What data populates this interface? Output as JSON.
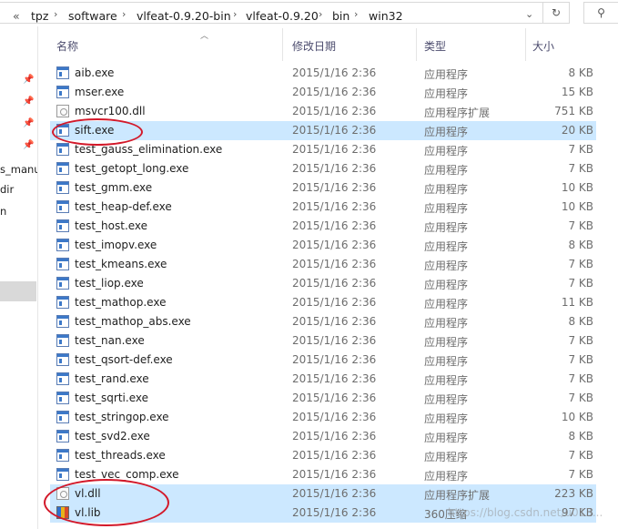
{
  "address": {
    "crumbs": [
      "tpz",
      "software",
      "vlfeat-0.9.20-bin",
      "vlfeat-0.9.20",
      "bin",
      "win32"
    ],
    "overflow": "«",
    "separator": "›"
  },
  "nav": {
    "texts": [
      "s_manu",
      "dir",
      "n"
    ]
  },
  "columns": {
    "name": "名称",
    "date": "修改日期",
    "type": "类型",
    "size": "大小"
  },
  "files": [
    {
      "name": "aib.exe",
      "date": "2015/1/16 2:36",
      "type": "应用程序",
      "size": "8 KB",
      "icon": "exe-icon"
    },
    {
      "name": "mser.exe",
      "date": "2015/1/16 2:36",
      "type": "应用程序",
      "size": "15 KB",
      "icon": "exe-icon"
    },
    {
      "name": "msvcr100.dll",
      "date": "2015/1/16 2:36",
      "type": "应用程序扩展",
      "size": "751 KB",
      "icon": "dll-icon"
    },
    {
      "name": "sift.exe",
      "date": "2015/1/16 2:36",
      "type": "应用程序",
      "size": "20 KB",
      "icon": "exe-icon"
    },
    {
      "name": "test_gauss_elimination.exe",
      "date": "2015/1/16 2:36",
      "type": "应用程序",
      "size": "7 KB",
      "icon": "exe-icon"
    },
    {
      "name": "test_getopt_long.exe",
      "date": "2015/1/16 2:36",
      "type": "应用程序",
      "size": "7 KB",
      "icon": "exe-icon"
    },
    {
      "name": "test_gmm.exe",
      "date": "2015/1/16 2:36",
      "type": "应用程序",
      "size": "10 KB",
      "icon": "exe-icon"
    },
    {
      "name": "test_heap-def.exe",
      "date": "2015/1/16 2:36",
      "type": "应用程序",
      "size": "10 KB",
      "icon": "exe-icon"
    },
    {
      "name": "test_host.exe",
      "date": "2015/1/16 2:36",
      "type": "应用程序",
      "size": "7 KB",
      "icon": "exe-icon"
    },
    {
      "name": "test_imopv.exe",
      "date": "2015/1/16 2:36",
      "type": "应用程序",
      "size": "8 KB",
      "icon": "exe-icon"
    },
    {
      "name": "test_kmeans.exe",
      "date": "2015/1/16 2:36",
      "type": "应用程序",
      "size": "7 KB",
      "icon": "exe-icon"
    },
    {
      "name": "test_liop.exe",
      "date": "2015/1/16 2:36",
      "type": "应用程序",
      "size": "7 KB",
      "icon": "exe-icon"
    },
    {
      "name": "test_mathop.exe",
      "date": "2015/1/16 2:36",
      "type": "应用程序",
      "size": "11 KB",
      "icon": "exe-icon"
    },
    {
      "name": "test_mathop_abs.exe",
      "date": "2015/1/16 2:36",
      "type": "应用程序",
      "size": "8 KB",
      "icon": "exe-icon"
    },
    {
      "name": "test_nan.exe",
      "date": "2015/1/16 2:36",
      "type": "应用程序",
      "size": "7 KB",
      "icon": "exe-icon"
    },
    {
      "name": "test_qsort-def.exe",
      "date": "2015/1/16 2:36",
      "type": "应用程序",
      "size": "7 KB",
      "icon": "exe-icon"
    },
    {
      "name": "test_rand.exe",
      "date": "2015/1/16 2:36",
      "type": "应用程序",
      "size": "7 KB",
      "icon": "exe-icon"
    },
    {
      "name": "test_sqrti.exe",
      "date": "2015/1/16 2:36",
      "type": "应用程序",
      "size": "7 KB",
      "icon": "exe-icon"
    },
    {
      "name": "test_stringop.exe",
      "date": "2015/1/16 2:36",
      "type": "应用程序",
      "size": "10 KB",
      "icon": "exe-icon"
    },
    {
      "name": "test_svd2.exe",
      "date": "2015/1/16 2:36",
      "type": "应用程序",
      "size": "8 KB",
      "icon": "exe-icon"
    },
    {
      "name": "test_threads.exe",
      "date": "2015/1/16 2:36",
      "type": "应用程序",
      "size": "7 KB",
      "icon": "exe-icon"
    },
    {
      "name": "test_vec_comp.exe",
      "date": "2015/1/16 2:36",
      "type": "应用程序",
      "size": "7 KB",
      "icon": "exe-icon"
    },
    {
      "name": "vl.dll",
      "date": "2015/1/16 2:36",
      "type": "应用程序扩展",
      "size": "223 KB",
      "icon": "dll-icon"
    },
    {
      "name": "vl.lib",
      "date": "2015/1/16 2:36",
      "type": "360压缩",
      "size": "97 KB",
      "icon": "lib-icon"
    }
  ],
  "selected_rows": [
    3,
    22,
    23
  ],
  "watermark": "https://blog.csdn.net/u013..."
}
